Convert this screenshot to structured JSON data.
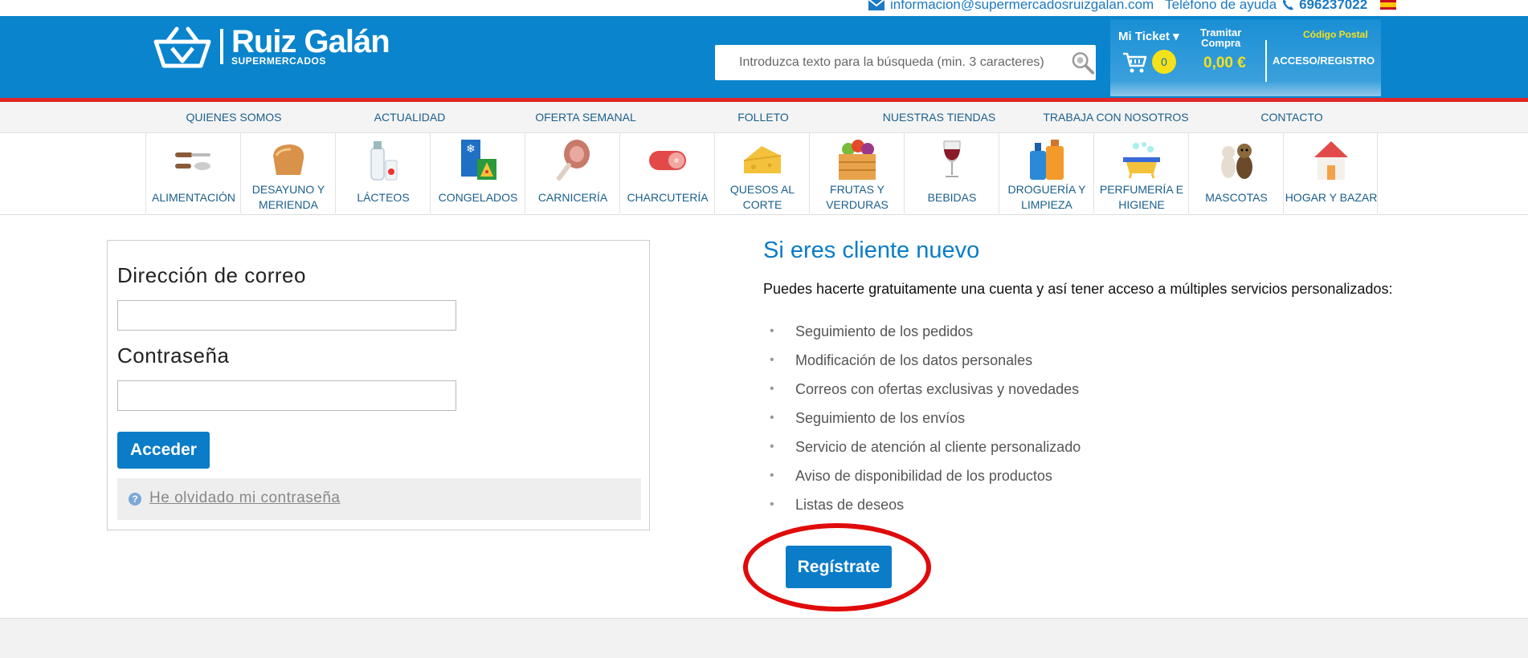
{
  "topbar": {
    "email": "informacion@supermercadosruizgalan.com",
    "help_label": "Teléfono de ayuda",
    "phone": "696237022"
  },
  "header": {
    "brand": "Ruiz Galán",
    "brand_sub": "SUPERMERCADOS",
    "search_placeholder": "Introduzca texto para la búsqueda (min. 3 caracteres)",
    "ticket_label": "Mi Ticket ▾",
    "cart_count": "0",
    "checkout_line1": "Tramitar",
    "checkout_line2": "Compra",
    "total": "0,00 €",
    "postal_code": "Código Postal",
    "account": "ACCESO/REGISTRO"
  },
  "nav": [
    "QUIENES SOMOS",
    "ACTUALIDAD",
    "OFERTA SEMANAL",
    "FOLLETO",
    "NUESTRAS TIENDAS",
    "TRABAJA CON NOSOTROS",
    "CONTACTO"
  ],
  "categories": [
    {
      "line1": "ALIMENTACIÓN",
      "line2": "",
      "icon": "cutlery-icon"
    },
    {
      "line1": "DESAYUNO Y",
      "line2": "MERIENDA",
      "icon": "bread-icon"
    },
    {
      "line1": "LÁCTEOS",
      "line2": "",
      "icon": "milk-icon"
    },
    {
      "line1": "CONGELADOS",
      "line2": "",
      "icon": "frozen-icon"
    },
    {
      "line1": "CARNICERÍA",
      "line2": "",
      "icon": "ham-icon"
    },
    {
      "line1": "CHARCUTERÍA",
      "line2": "",
      "icon": "sausage-icon"
    },
    {
      "line1": "QUESOS AL",
      "line2": "CORTE",
      "icon": "cheese-icon"
    },
    {
      "line1": "FRUTAS Y",
      "line2": "VERDURAS",
      "icon": "fruit-crate-icon"
    },
    {
      "line1": "BEBIDAS",
      "line2": "",
      "icon": "wine-glass-icon"
    },
    {
      "line1": "DROGUERÍA Y",
      "line2": "LIMPIEZA",
      "icon": "detergent-icon"
    },
    {
      "line1": "PERFUMERÍA E",
      "line2": "HIGIENE",
      "icon": "bathtub-icon"
    },
    {
      "line1": "MASCOTAS",
      "line2": "",
      "icon": "pets-icon"
    },
    {
      "line1": "HOGAR Y BAZAR",
      "line2": "",
      "icon": "house-icon"
    }
  ],
  "login": {
    "email_label": "Dirección de correo",
    "email_value": "",
    "password_label": "Contraseña",
    "password_value": "",
    "submit": "Acceder",
    "forgot": "He olvidado mi contraseña"
  },
  "register": {
    "title": "Si eres cliente nuevo",
    "description": "Puedes hacerte gratuitamente una cuenta y así tener acceso a múltiples servicios personalizados:",
    "benefits": [
      "Seguimiento de los pedidos",
      "Modificación de los datos personales",
      "Correos con ofertas exclusivas y novedades",
      "Seguimiento de los envíos",
      "Servicio de atención al cliente personalizado",
      "Aviso de disponibilidad de los productos",
      "Listas de deseos"
    ],
    "button": "Regístrate"
  },
  "colors": {
    "header_blue": "#0a84cc",
    "accent_red": "#e02628",
    "button_blue": "#0a7cc8",
    "price_yellow": "#f5e11a",
    "highlight_ring": "#e00b0b"
  }
}
